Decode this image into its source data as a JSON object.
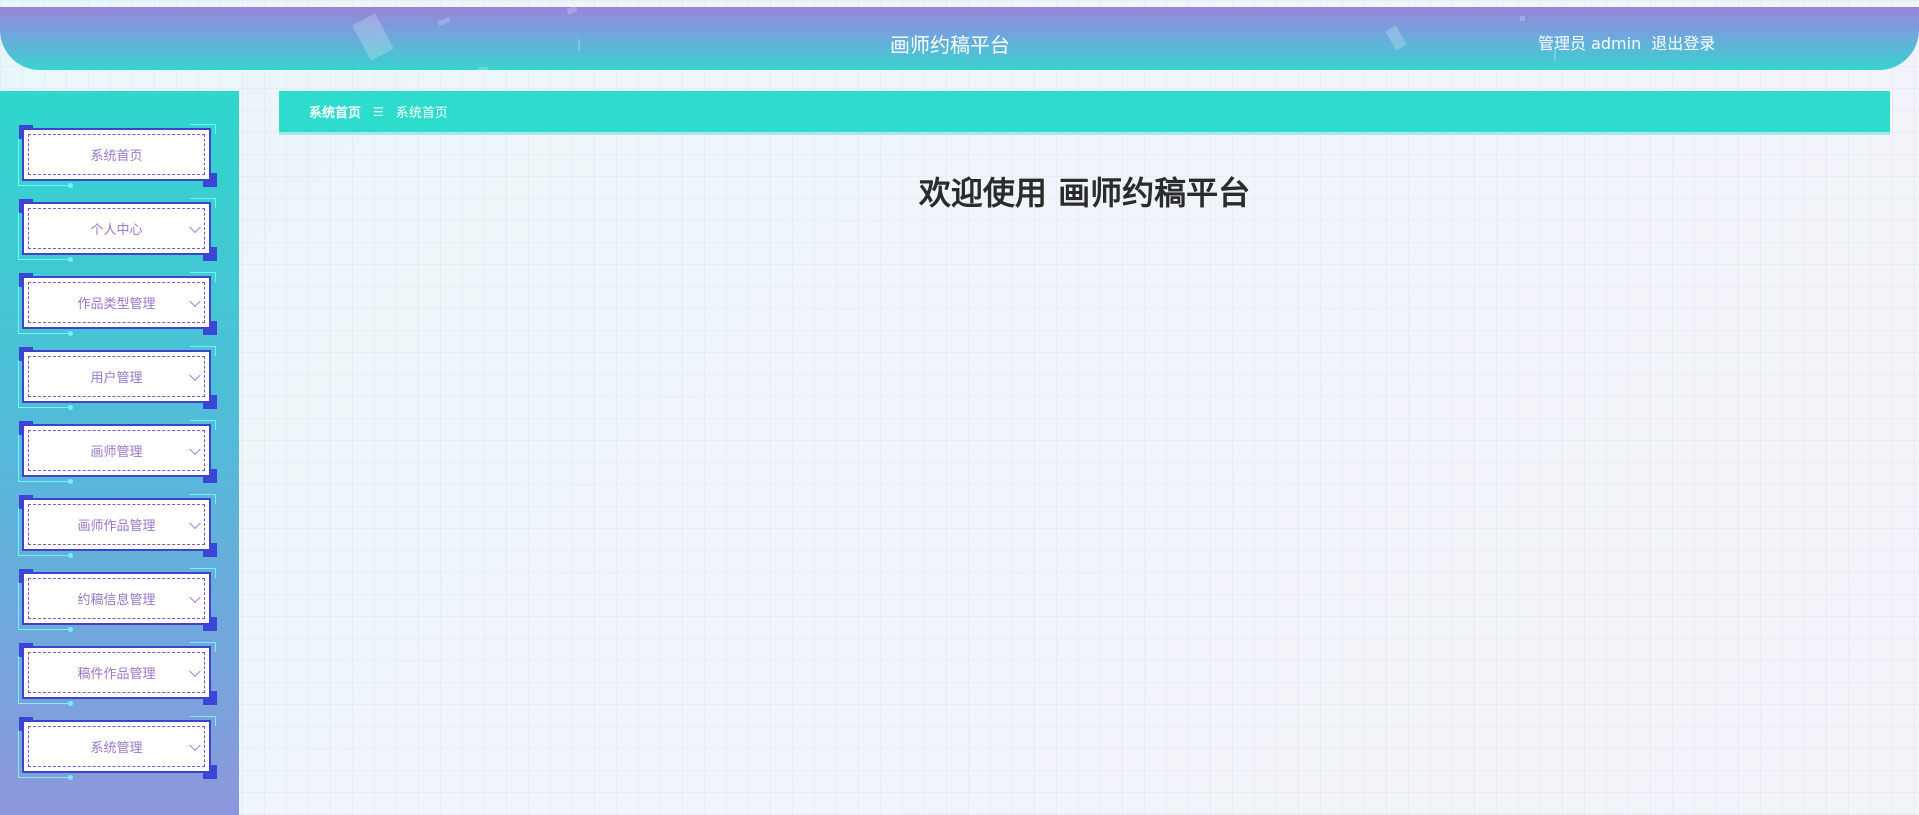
{
  "header": {
    "app_title": "画师约稿平台",
    "user_label": "管理员 admin",
    "logout_label": "退出登录"
  },
  "sidebar": {
    "items": [
      {
        "label": "系统首页",
        "has_submenu": false
      },
      {
        "label": "个人中心",
        "has_submenu": true
      },
      {
        "label": "作品类型管理",
        "has_submenu": true
      },
      {
        "label": "用户管理",
        "has_submenu": true
      },
      {
        "label": "画师管理",
        "has_submenu": true
      },
      {
        "label": "画师作品管理",
        "has_submenu": true
      },
      {
        "label": "约稿信息管理",
        "has_submenu": true
      },
      {
        "label": "稿件作品管理",
        "has_submenu": true
      },
      {
        "label": "系统管理",
        "has_submenu": true
      }
    ]
  },
  "breadcrumb": {
    "home": "系统首页",
    "separator": "☰",
    "current": "系统首页"
  },
  "main": {
    "welcome": "欢迎使用 画师约稿平台"
  },
  "colors": {
    "accent": "#2ddccd",
    "menu_text": "#9b76c9",
    "menu_border": "#3d44c9"
  }
}
